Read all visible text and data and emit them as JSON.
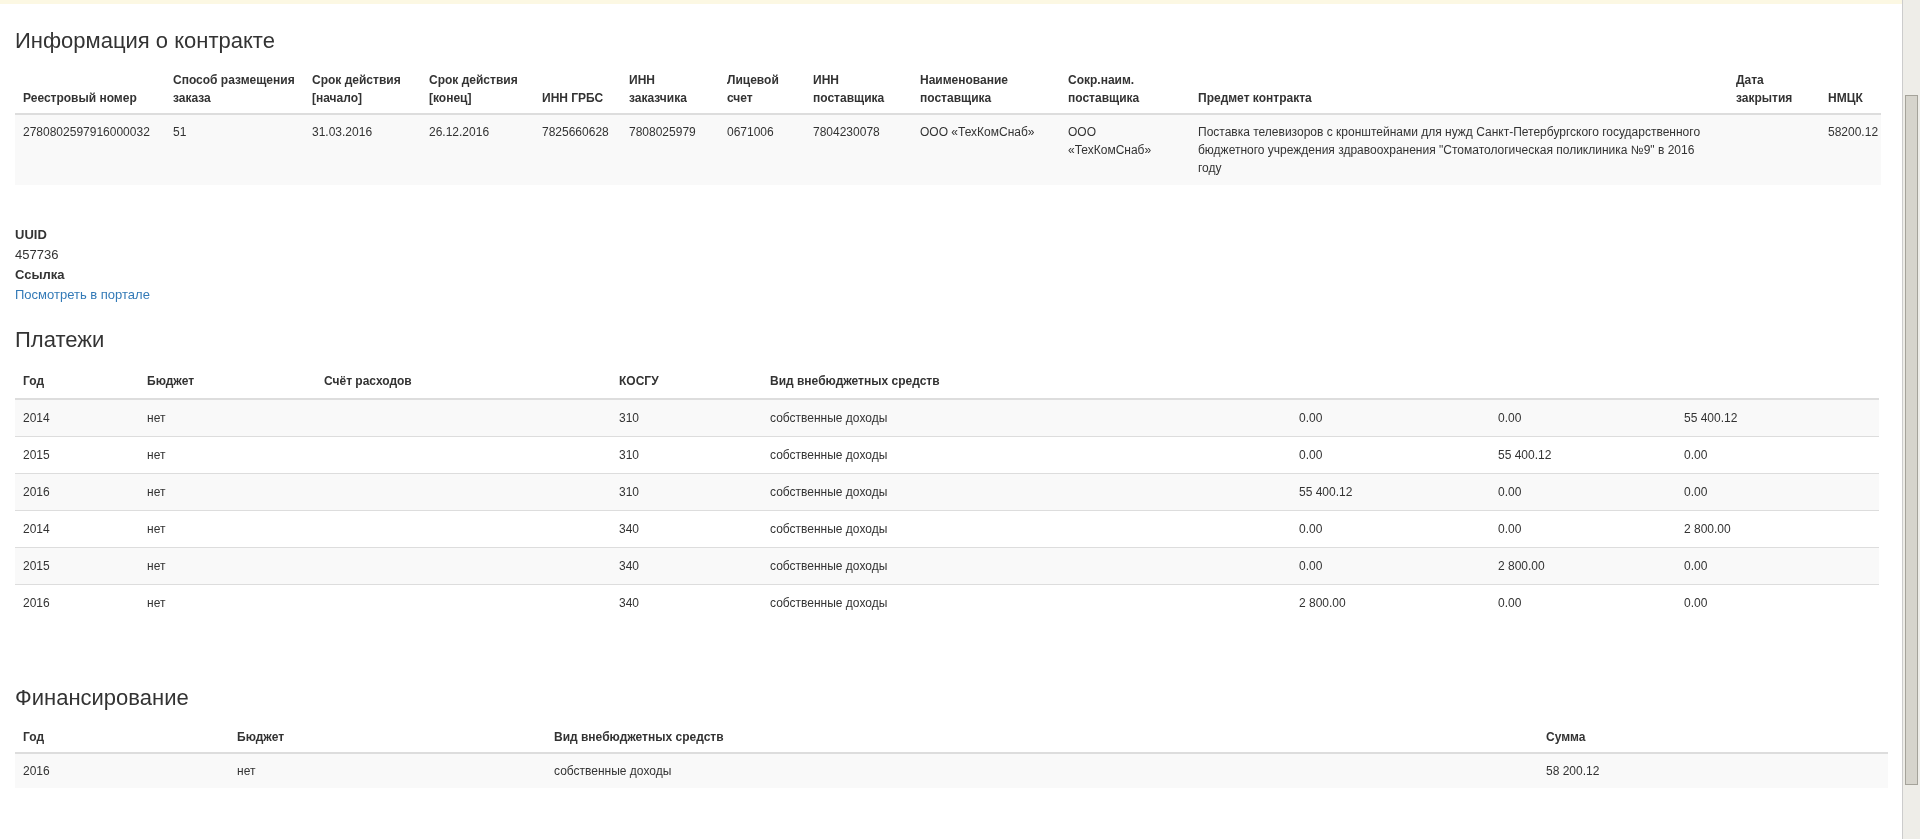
{
  "contract": {
    "title": "Информация о контракте",
    "columns": [
      "Реестровый номер",
      "Способ размещения заказа",
      "Срок действия [начало]",
      "Срок действия [конец]",
      "ИНН ГРБС",
      "ИНН заказчика",
      "Лицевой счет",
      "ИНН поставщика",
      "Наименование поставщика",
      "Сокр.наим. поставщика",
      "Предмет контракта",
      "Дата закрытия",
      "НМЦК"
    ],
    "rows": [
      [
        "2780802597916000032",
        "51",
        "31.03.2016",
        "26.12.2016",
        "7825660628",
        "7808025979",
        "0671006",
        "7804230078",
        "ООО «ТехКомСнаб»",
        "ООО «ТехКомСнаб»",
        "Поставка телевизоров с кронштейнами для нужд Санкт-Петербургского государственного бюджетного учреждения здравоохранения \"Стоматологическая поликлиника №9\" в 2016 году",
        "",
        "58200.12"
      ]
    ]
  },
  "details": [
    {
      "label": "UUID",
      "value": "457736",
      "kind": "text"
    },
    {
      "label": "Ссылка",
      "value": "Посмотреть в портале",
      "kind": "link"
    }
  ],
  "payments": {
    "title": "Платежи",
    "columns": [
      "Год",
      "Бюджет",
      "Счёт расходов",
      "КОСГУ",
      "Вид внебюджетных средств",
      "",
      "",
      ""
    ],
    "rows": [
      [
        "2014",
        "нет",
        "",
        "310",
        "собственные доходы",
        "0.00",
        "0.00",
        "55 400.12"
      ],
      [
        "2015",
        "нет",
        "",
        "310",
        "собственные доходы",
        "0.00",
        "55 400.12",
        "0.00"
      ],
      [
        "2016",
        "нет",
        "",
        "310",
        "собственные доходы",
        "55 400.12",
        "0.00",
        "0.00"
      ],
      [
        "2014",
        "нет",
        "",
        "340",
        "собственные доходы",
        "0.00",
        "0.00",
        "2 800.00"
      ],
      [
        "2015",
        "нет",
        "",
        "340",
        "собственные доходы",
        "0.00",
        "2 800.00",
        "0.00"
      ],
      [
        "2016",
        "нет",
        "",
        "340",
        "собственные доходы",
        "2 800.00",
        "0.00",
        "0.00"
      ]
    ]
  },
  "financing": {
    "title": "Финансирование",
    "columns": [
      "Год",
      "Бюджет",
      "Вид внебюджетных средств",
      "Сумма"
    ],
    "rows": [
      [
        "2016",
        "нет",
        "собственные доходы",
        "58 200.12"
      ]
    ]
  }
}
